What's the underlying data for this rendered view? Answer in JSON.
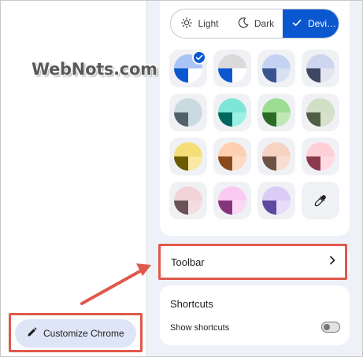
{
  "watermark": {
    "text": "WebNots.com"
  },
  "appearance": {
    "modes": [
      {
        "label": "Light",
        "icon": "sun-icon"
      },
      {
        "label": "Dark",
        "icon": "moon-icon"
      },
      {
        "label": "Devi…",
        "icon": "check-icon",
        "selected": true
      }
    ],
    "swatches": [
      {
        "name": "default-blue",
        "top": "#aac4f6",
        "left": "#0b57d0",
        "right": "#ffffff",
        "selected": true
      },
      {
        "name": "grey",
        "top": "#dadada",
        "left": "#0b57d0",
        "right": "#ffffff"
      },
      {
        "name": "light-blue",
        "top": "#c5d3f2",
        "left": "#3a5490",
        "right": "#d8e0f4"
      },
      {
        "name": "periwinkle",
        "top": "#cdd6ee",
        "left": "#3d4663",
        "right": "#e3e6f0"
      },
      {
        "name": "slate",
        "top": "#c9dbe0",
        "left": "#51616a",
        "right": "#c9dbe0"
      },
      {
        "name": "teal",
        "top": "#7ee6d8",
        "left": "#00685e",
        "right": "#9af0e3"
      },
      {
        "name": "green",
        "top": "#9ddd92",
        "left": "#2c6b25",
        "right": "#bfe8b6"
      },
      {
        "name": "sage",
        "top": "#d1dfc7",
        "left": "#4f5e44",
        "right": "#d6e1cc"
      },
      {
        "name": "yellow",
        "top": "#f5dd77",
        "left": "#6b5a00",
        "right": "#fbe9a1"
      },
      {
        "name": "orange",
        "top": "#ffcfb2",
        "left": "#8a4a1c",
        "right": "#ffdac4"
      },
      {
        "name": "apricot",
        "top": "#f7d3c4",
        "left": "#6e5247",
        "right": "#f9ddd0"
      },
      {
        "name": "pink",
        "top": "#ffcfd6",
        "left": "#8b3a4d",
        "right": "#ffdbe1"
      },
      {
        "name": "rose",
        "top": "#f1d3d8",
        "left": "#6a5358",
        "right": "#f4dde0"
      },
      {
        "name": "magenta",
        "top": "#fbcaf3",
        "left": "#86357a",
        "right": "#fbd8f5"
      },
      {
        "name": "lavender",
        "top": "#dccbf7",
        "left": "#5c4aa0",
        "right": "#e6dbf9"
      }
    ],
    "eyedropper_icon": "eyedropper-icon"
  },
  "toolbar": {
    "label": "Toolbar",
    "chevron_icon": "chevron-right-icon"
  },
  "shortcuts": {
    "title": "Shortcuts",
    "toggle_label": "Show shortcuts",
    "enabled": false
  },
  "customize_button": {
    "label": "Customize Chrome",
    "icon": "pencil-icon"
  },
  "colors": {
    "accent": "#0b57d0",
    "annotation": "#e0584a",
    "panel_bg": "#eef1f8"
  }
}
